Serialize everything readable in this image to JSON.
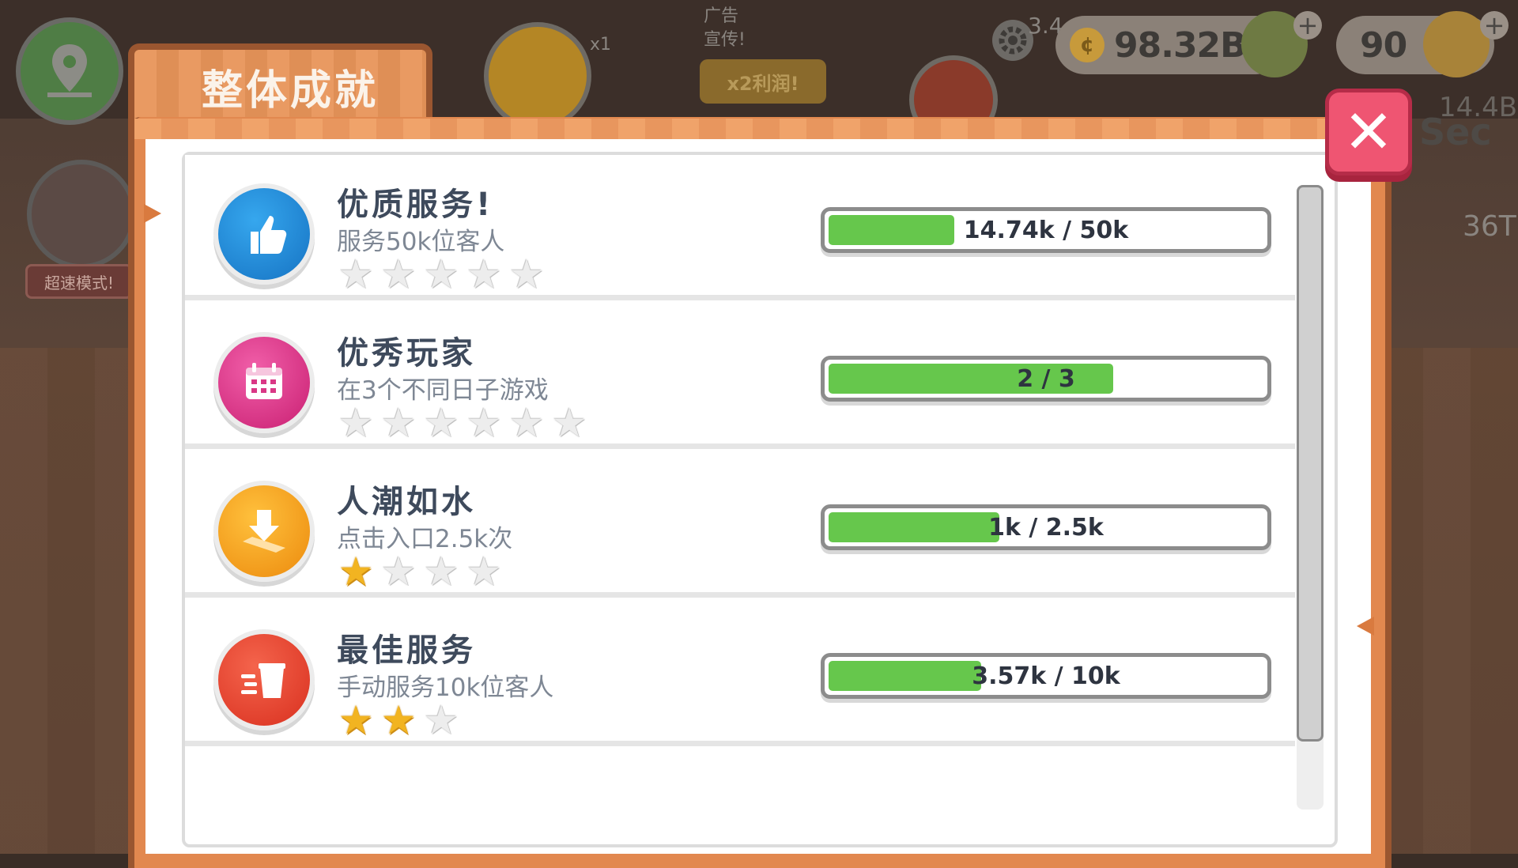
{
  "hud": {
    "coins": "98.32B",
    "gems": "90",
    "rating_partial": "3.4",
    "ad_label": "广告\n宣传!",
    "ad_button": "x2利润!",
    "multiplier": "x1",
    "sec_label": "Sec",
    "side_mode": "超速模式!",
    "side_value": "36T",
    "side_value_top": "14.4B"
  },
  "panel": {
    "title": "整体成就"
  },
  "achievements": [
    {
      "name": "优质服务!",
      "description": "服务50k位客人",
      "progress_text": "14.74k / 50k",
      "progress": 0.2948,
      "stars_earned": 0,
      "stars_total": 5,
      "icon": "thumbs-up-icon",
      "icon_color": "#1f8fd6"
    },
    {
      "name": "优秀玩家",
      "description": "在3个不同日子游戏",
      "progress_text": "2 / 3",
      "progress": 0.6667,
      "stars_earned": 0,
      "stars_total": 6,
      "icon": "calendar-icon",
      "icon_color": "#e2338a"
    },
    {
      "name": "人潮如水",
      "description": "点击入口2.5k次",
      "progress_text": "1k / 2.5k",
      "progress": 0.4,
      "stars_earned": 1,
      "stars_total": 4,
      "icon": "download-tap-icon",
      "icon_color": "#f39a17"
    },
    {
      "name": "最佳服务",
      "description": "手动服务10k位客人",
      "progress_text": "3.57k / 10k",
      "progress": 0.357,
      "stars_earned": 2,
      "stars_total": 3,
      "icon": "fast-cup-icon",
      "icon_color": "#e8432e"
    }
  ],
  "colors": {
    "progress_fill": "#66c74c",
    "star_on": "#f2b421",
    "close_button": "#ef5572",
    "panel_orange": "#e2884f"
  }
}
